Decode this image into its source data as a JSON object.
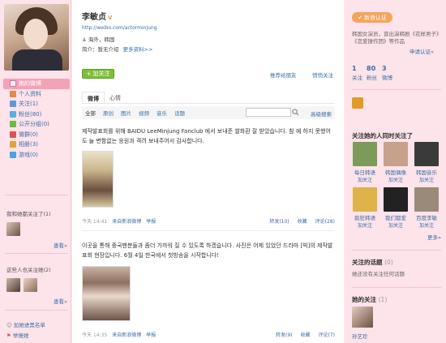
{
  "profile": {
    "name": "李敏贞",
    "verified_mark": "V",
    "url": "http://weibo.com/actorminjung",
    "location": "海外，韩国",
    "bio_label": "简介：",
    "bio_value": "暂无介绍",
    "more_info": "更多资料>>"
  },
  "actions": {
    "follow": "+ 加关注",
    "recommend": "推荐给朋友",
    "message": "悄悄关注"
  },
  "left_nav": {
    "items": [
      {
        "label": "她的微博",
        "icon": "home-icon",
        "color": "#e56b8c"
      },
      {
        "label": "个人资料",
        "icon": "profile-icon",
        "color": "#e58a4a"
      },
      {
        "label": "关注(1)",
        "icon": "follow-icon",
        "color": "#5b9bd5"
      },
      {
        "label": "粉丝(80)",
        "icon": "fans-icon",
        "color": "#5ab0d9"
      },
      {
        "label": "公开分组(0)",
        "icon": "group-icon",
        "color": "#6fb845"
      },
      {
        "label": "微群(0)",
        "icon": "weiqun-icon",
        "color": "#d9534f"
      },
      {
        "label": "相册(3)",
        "icon": "album-icon",
        "color": "#e0a33a"
      },
      {
        "label": "游戏(0)",
        "icon": "game-icon",
        "color": "#4aa3df"
      }
    ],
    "common_title": "我和她都关注了(1)",
    "common_more": "查看»",
    "also_title": "这些人也关注她(2)",
    "also_more": "查看»",
    "blacklist": "加她进黑名单",
    "report": "举报她"
  },
  "tabs": {
    "items": [
      "微博",
      "心情"
    ],
    "active": "微博"
  },
  "filters": {
    "items": [
      "全部",
      "原创",
      "图片",
      "视频",
      "音乐",
      "话题"
    ],
    "search_placeholder": "",
    "advanced": "高级搜索"
  },
  "posts": [
    {
      "text": "제작발표회를 위해 BAIDU LeeMinjung Fanclub 에서 보내준 쌀화환 잘 받았습니다. 참 예 하지 못했어도 늘 변함없는 응원과 격려 보내주어서 감사합니다.",
      "time": "今天 14:41",
      "source": "来自新浪微博",
      "report": "举报",
      "repost": "转发(10)",
      "fav": "收藏",
      "comment": "评论(28)"
    },
    {
      "text": "이곳을 통해 중국팬분들과 좀더 가까워 질 수 있도록 하겠습니다. 사진은 어제 있었던 드라마 [빅]의 제작발표회 현장입니다. 6월 4일 한국에서 첫방송을 시작합니다!",
      "time": "今天 14:35",
      "source": "来自新浪微博",
      "report": "举报",
      "repost": "转发(9)",
      "fav": "收藏",
      "comment": "评论(7)"
    }
  ],
  "right": {
    "cert_badge": "新浪认证",
    "cert_desc": "韩国女演员，曾出演韩剧《花样男子》《恋爱操作团》等作品",
    "cert_link": "申请认证»",
    "stats": [
      {
        "num": "1",
        "label": "关注"
      },
      {
        "num": "80",
        "label": "粉丝"
      },
      {
        "num": "3",
        "label": "微博"
      }
    ],
    "common_follow_title": "关注她的人同时关注了",
    "follow_items": [
      {
        "name": "每日韩语",
        "act": "加关注",
        "color": "#7c9a5a"
      },
      {
        "name": "韩国偶像",
        "act": "加关注",
        "color": "#c6a28c"
      },
      {
        "name": "韩国音乐",
        "act": "加关注",
        "color": "#3a3a3a"
      },
      {
        "name": "疯狂韩语",
        "act": "加关注",
        "color": "#e0b24a"
      },
      {
        "name": "我们都爱",
        "act": "加关注",
        "color": "#222222"
      },
      {
        "name": "百度李敏",
        "act": "加关注",
        "color": "#9a8a7a"
      }
    ],
    "follow_more": "更多»",
    "topic_title": "关注的话题",
    "topic_count": "(0)",
    "topic_empty": "她还没有关注任何话题",
    "her_follow_title": "她的关注",
    "her_follow_count": "(1)",
    "her_follow_name": "孙艺珍"
  }
}
